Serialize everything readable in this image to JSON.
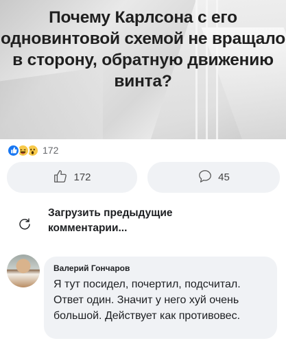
{
  "post": {
    "title": "Почему Карлсона с его одновинтовой схемой не вращало в сторону, обратную движению винта?"
  },
  "reactions": {
    "count": "172",
    "types": [
      "like-icon",
      "haha-icon",
      "wow-icon"
    ]
  },
  "actions": {
    "like_count": "172",
    "comment_count": "45"
  },
  "comments": {
    "load_previous_label": "Загрузить предыдущие комментарии...",
    "items": [
      {
        "author": "Валерий Гончаров",
        "text": "Я тут посидел, почертил, подсчитал. Ответ один. Значит у него хуй очень большой. Действует как противовес."
      }
    ]
  },
  "colors": {
    "accent": "#1877f2",
    "bubble_bg": "#f0f2f5",
    "secondary_text": "#65676b"
  }
}
